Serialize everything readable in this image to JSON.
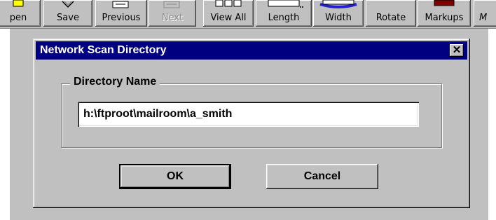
{
  "toolbar": {
    "buttons": [
      {
        "label": "pen",
        "icon": "open-folder-icon",
        "disabled": false
      },
      {
        "label": "Save",
        "icon": "save-icon",
        "disabled": false
      },
      {
        "label": "Previous",
        "icon": "previous-page-icon",
        "disabled": false
      },
      {
        "label": "Next",
        "icon": "next-page-icon",
        "disabled": true
      },
      {
        "label": "View All",
        "icon": "view-all-icon",
        "disabled": false
      },
      {
        "label": "Length",
        "icon": "length-icon",
        "disabled": false
      },
      {
        "label": "Width",
        "icon": "width-icon",
        "disabled": false
      },
      {
        "label": "Rotate",
        "icon": "rotate-icon",
        "disabled": false
      },
      {
        "label": "Markups",
        "icon": "markups-icon",
        "disabled": false
      },
      {
        "label": "M",
        "icon": "more-icon",
        "disabled": false
      }
    ]
  },
  "dialog": {
    "title": "Network Scan Directory",
    "close_label": "✕",
    "group_label": "Directory Name",
    "directory_value": "h:\\ftproot\\mailroom\\a_smith",
    "ok_label": "OK",
    "cancel_label": "Cancel"
  },
  "colors": {
    "title_bar": "#000080",
    "face": "#c0c0c0",
    "workspace": "#c0c0c0",
    "highlight_blue": "#2020d0"
  }
}
